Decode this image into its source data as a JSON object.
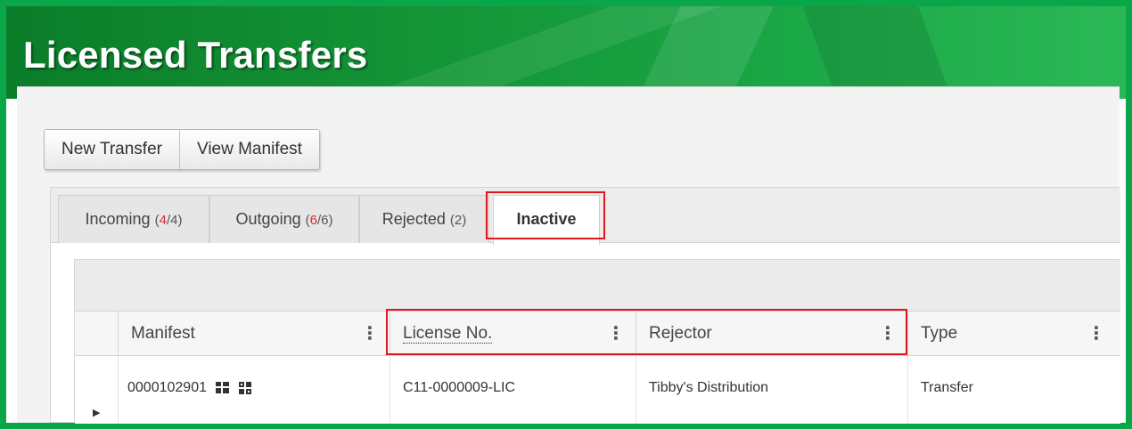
{
  "page": {
    "title": "Licensed Transfers"
  },
  "toolbar": {
    "new_transfer_label": "New Transfer",
    "view_manifest_label": "View Manifest"
  },
  "tabs": [
    {
      "label": "Incoming",
      "count_open": "(",
      "count_active": "4",
      "count_rest": "/4)"
    },
    {
      "label": "Outgoing",
      "count_open": "(",
      "count_active": "6",
      "count_rest": "/6)"
    },
    {
      "label": "Rejected",
      "count_text": "(2)"
    },
    {
      "label": "Inactive"
    }
  ],
  "grid": {
    "columns": [
      "Manifest",
      "License No.",
      "Rejector",
      "Type"
    ],
    "menu_glyph": "⋮",
    "rows": [
      {
        "manifest": "0000102901",
        "license_no": "C11-0000009-LIC",
        "rejector": "Tibby's Distribution",
        "type": "Transfer"
      }
    ]
  },
  "icons": {
    "expander": "triangle-right-icon",
    "manifest_icons": [
      "grid-icon",
      "grid-alt-icon"
    ]
  },
  "colors": {
    "brand_green": "#0aa64a",
    "highlight_red": "#e3141c",
    "count_red": "#e02b2b"
  }
}
